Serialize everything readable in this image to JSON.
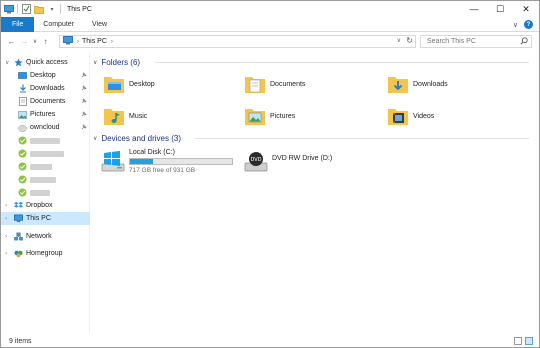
{
  "window": {
    "title": "This PC",
    "controls": {
      "minimize": "—",
      "maximize": "☐",
      "close": "✕"
    }
  },
  "ribbon": {
    "tabs": [
      "File",
      "Computer",
      "View"
    ],
    "expand_icon": "∨",
    "help_icon": "?"
  },
  "nav": {
    "back": "←",
    "forward": "→",
    "recent": "∨",
    "up": "↑"
  },
  "address": {
    "path_root_arrow": "›",
    "location": "This PC",
    "path_arrow": "›",
    "dropdown": "∨",
    "refresh": "↻"
  },
  "search": {
    "placeholder": "Search This PC",
    "icon": "search-icon"
  },
  "sidebar": {
    "quick_access": "Quick access",
    "items": [
      {
        "label": "Desktop",
        "pinned": true
      },
      {
        "label": "Downloads",
        "pinned": true
      },
      {
        "label": "Documents",
        "pinned": true
      },
      {
        "label": "Pictures",
        "pinned": true
      },
      {
        "label": "owncloud",
        "pinned": true
      }
    ],
    "pin_glyph": "📌",
    "chevron_collapsed": "›",
    "chevron_expanded": "∨",
    "dropbox": "Dropbox",
    "this_pc": "This PC",
    "network": "Network",
    "homegroup": "Homegroup"
  },
  "main": {
    "folders_header": "Folders (6)",
    "folders": [
      {
        "label": "Desktop"
      },
      {
        "label": "Documents"
      },
      {
        "label": "Downloads"
      },
      {
        "label": "Music"
      },
      {
        "label": "Pictures"
      },
      {
        "label": "Videos"
      }
    ],
    "devices_header": "Devices and drives (3)",
    "drives": [
      {
        "name": "Local Disk (C:)",
        "free_text": "717 GB free of 931 GB",
        "used_fraction": 0.23
      },
      {
        "name": "DVD RW Drive (D:)"
      }
    ]
  },
  "status": {
    "items": "9 items"
  },
  "colors": {
    "accent": "#1979ca",
    "selection": "#cce8ff",
    "folder": "#f3c54f",
    "drive_fill": "#26a0da",
    "header_text": "#1e3287"
  }
}
